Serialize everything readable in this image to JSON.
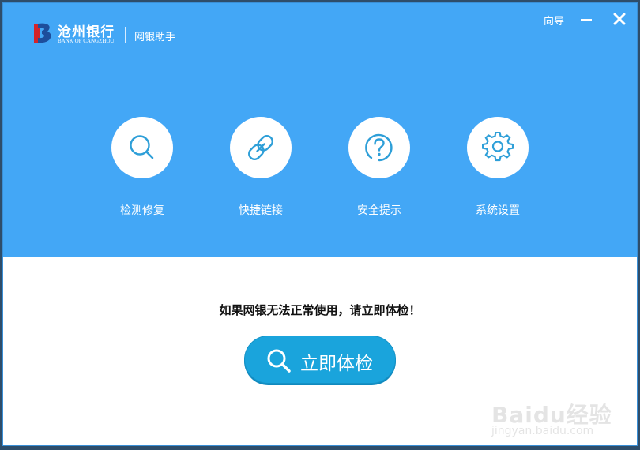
{
  "window": {
    "brand_color": "#43a7f6",
    "accent_color": "#1aa4dc"
  },
  "titlebar": {
    "logo": {
      "name_cn": "沧州银行",
      "name_en": "BANK OF CANGZHOU",
      "icon": "bank-logo-icon"
    },
    "app_name": "网银助手",
    "guide_label": "向导",
    "minimize_icon": "minimize-icon",
    "close_icon": "close-icon"
  },
  "tools": [
    {
      "label": "检测修复",
      "icon": "search-icon"
    },
    {
      "label": "快捷链接",
      "icon": "link-icon"
    },
    {
      "label": "安全提示",
      "icon": "question-icon"
    },
    {
      "label": "系统设置",
      "icon": "gear-icon"
    }
  ],
  "main": {
    "prompt": "如果网银无法正常使用，请立即体检！",
    "check_button_label": "立即体检",
    "check_button_icon": "search-icon"
  },
  "watermark": {
    "text": "Baidu经验",
    "url_text": "jingyan.baidu.com"
  }
}
